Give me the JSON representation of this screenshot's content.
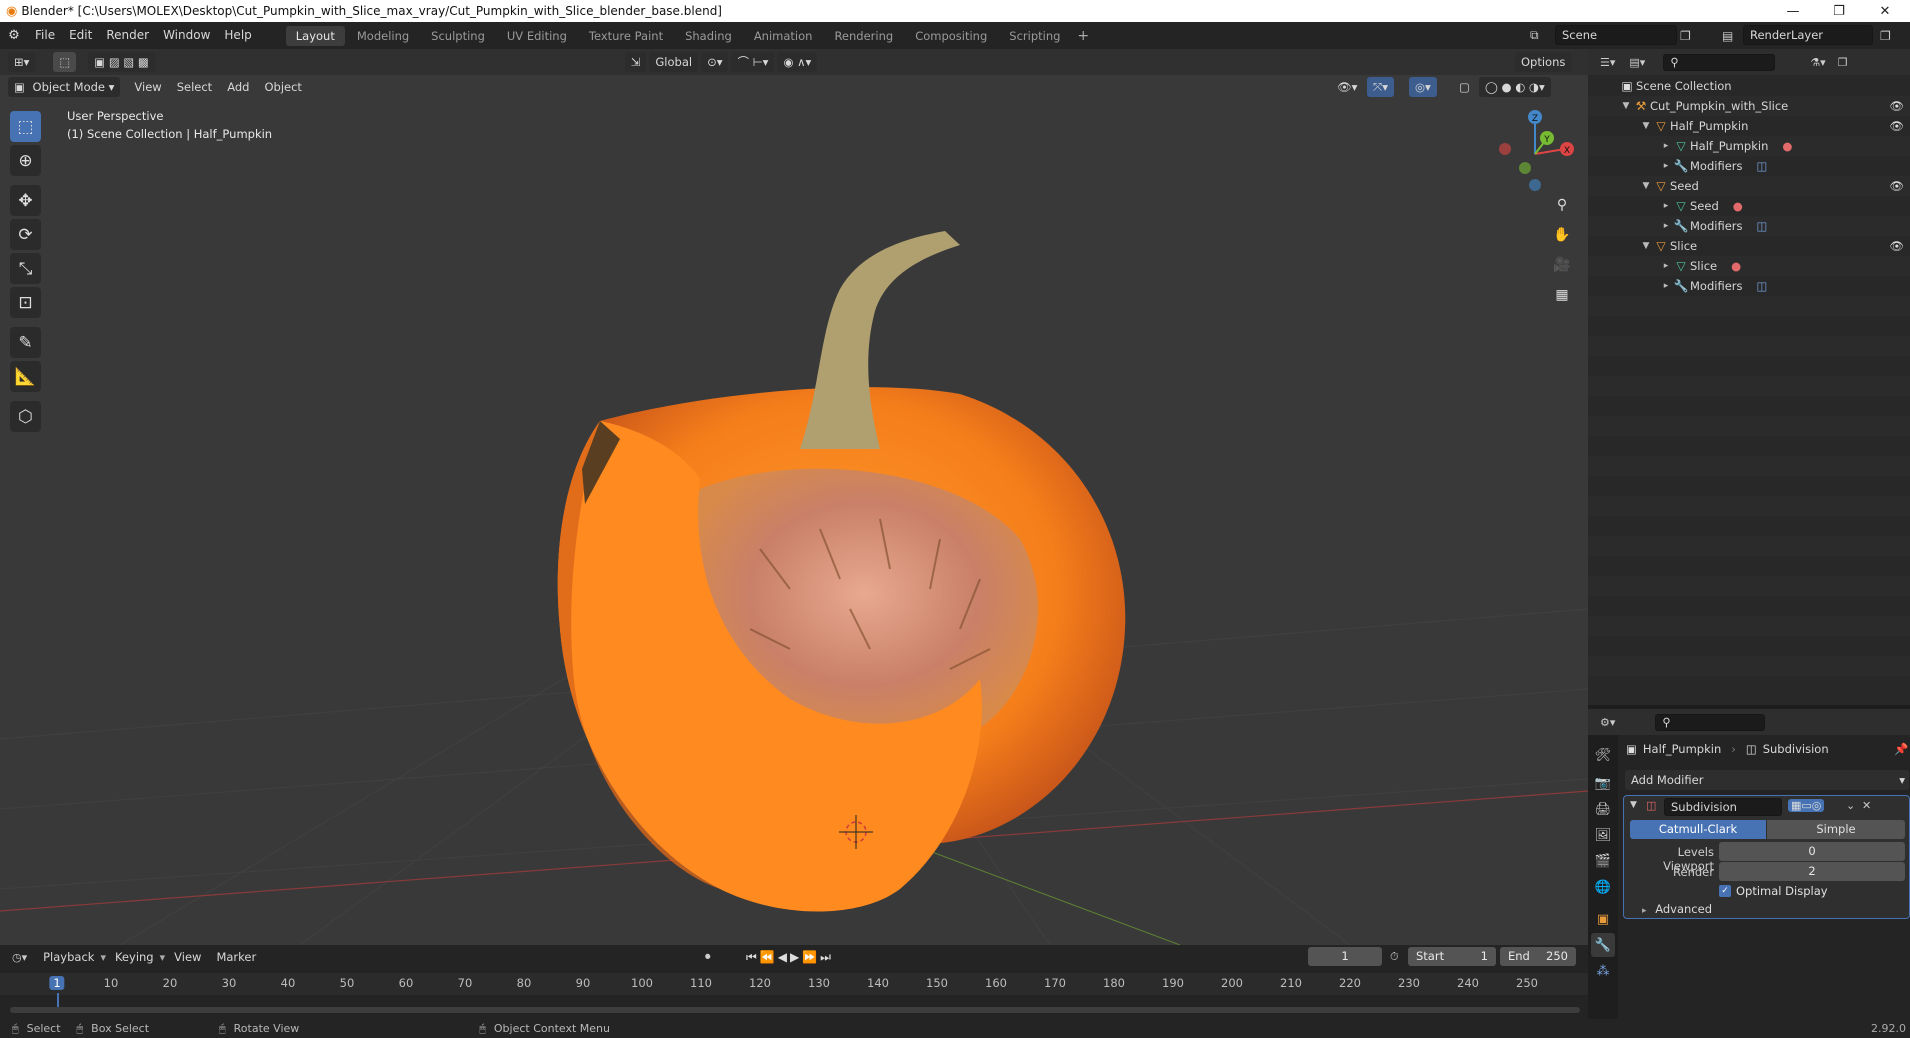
{
  "window": {
    "title": "Blender* [C:\\Users\\MOLEX\\Desktop\\Cut_Pumpkin_with_Slice_max_vray/Cut_Pumpkin_with_Slice_blender_base.blend]"
  },
  "menu": [
    "File",
    "Edit",
    "Render",
    "Window",
    "Help"
  ],
  "workspaces": [
    "Layout",
    "Modeling",
    "Sculpting",
    "UV Editing",
    "Texture Paint",
    "Shading",
    "Animation",
    "Rendering",
    "Compositing",
    "Scripting"
  ],
  "workspace_active": "Layout",
  "scene": {
    "name": "Scene",
    "render_layer": "RenderLayer"
  },
  "viewport": {
    "transform_orientation": "Global",
    "options_label": "Options",
    "mode": "Object Mode",
    "menus": [
      "View",
      "Select",
      "Add",
      "Object"
    ],
    "overlay_title": "User Perspective",
    "overlay_subtitle": "(1) Scene Collection | Half_Pumpkin",
    "gizmo_axes": {
      "x": "X",
      "y": "Y",
      "z": "Z"
    }
  },
  "outliner": {
    "root": "Scene Collection",
    "items": [
      {
        "label": "Cut_Pumpkin_with_Slice",
        "icon": "armature-icon"
      },
      {
        "label": "Half_Pumpkin",
        "icon": "object-icon"
      },
      {
        "label": "Half_Pumpkin",
        "icon": "mesh-icon"
      },
      {
        "label": "Modifiers",
        "icon": "wrench-icon"
      },
      {
        "label": "Seed",
        "icon": "object-icon"
      },
      {
        "label": "Seed",
        "icon": "mesh-icon"
      },
      {
        "label": "Modifiers",
        "icon": "wrench-icon"
      },
      {
        "label": "Slice",
        "icon": "object-icon"
      },
      {
        "label": "Slice",
        "icon": "mesh-icon"
      },
      {
        "label": "Modifiers",
        "icon": "wrench-icon"
      }
    ]
  },
  "properties": {
    "breadcrumb_object": "Half_Pumpkin",
    "breadcrumb_modifier": "Subdivision",
    "add_modifier": "Add Modifier",
    "modifier_name": "Subdivision",
    "algo_catmull": "Catmull-Clark",
    "algo_simple": "Simple",
    "levels_viewport_label": "Levels Viewport",
    "levels_viewport_value": "0",
    "render_label": "Render",
    "render_value": "2",
    "optimal_display": "Optimal Display",
    "advanced": "Advanced",
    "version": "2.92.0"
  },
  "timeline": {
    "menus": [
      "Playback",
      "Keying",
      "View",
      "Marker"
    ],
    "current_frame": "1",
    "start_label": "Start",
    "start_value": "1",
    "end_label": "End",
    "end_value": "250",
    "ticks": [
      "1",
      "10",
      "20",
      "30",
      "40",
      "50",
      "60",
      "70",
      "80",
      "90",
      "100",
      "110",
      "120",
      "130",
      "140",
      "150",
      "160",
      "170",
      "180",
      "190",
      "200",
      "210",
      "220",
      "230",
      "240",
      "250"
    ]
  },
  "status": {
    "select": "Select",
    "box_select": "Box Select",
    "rotate_view": "Rotate View",
    "context_menu": "Object Context Menu"
  }
}
